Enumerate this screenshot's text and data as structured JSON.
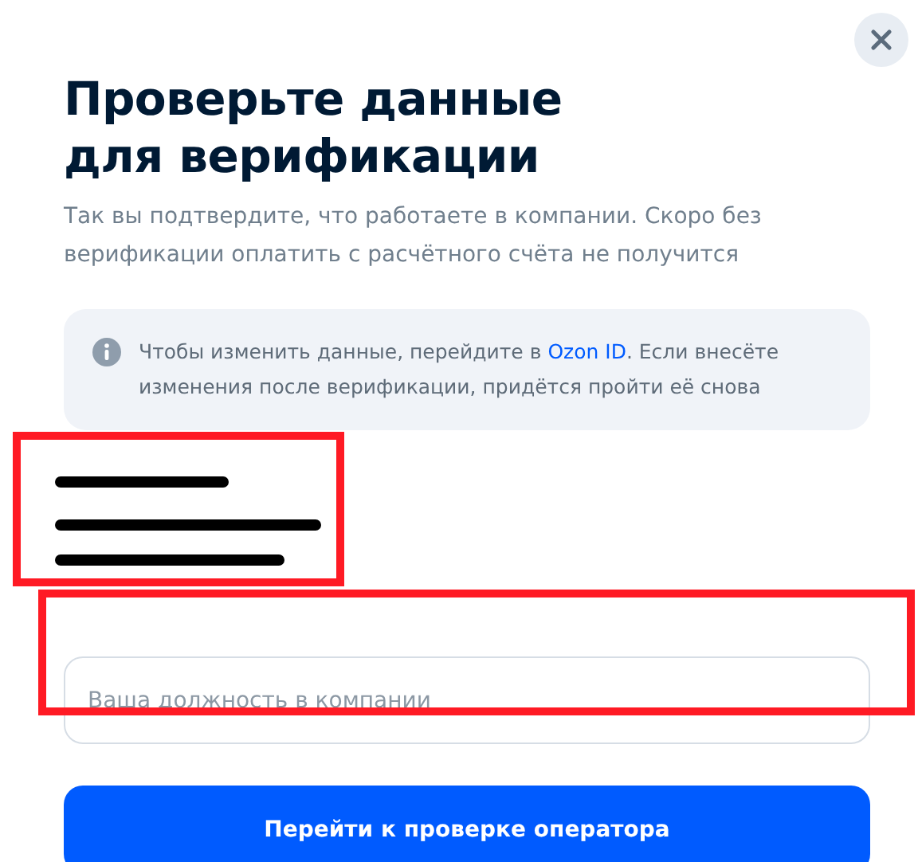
{
  "dialog": {
    "title": "Проверьте данные для верификации",
    "subtitle": "Так вы подтвердите, что работаете в компании. Скоро без верификации оплатить с расчётного счёта не получится",
    "notice": {
      "before": "Чтобы изменить данные, перейдите в ",
      "link": "Ozon ID",
      "after": ". Если внесёте изменения после верификации, придётся пройти её снова"
    },
    "position_field": {
      "placeholder": "Ваша должность в компании"
    },
    "submit_button": "Перейти к проверке оператора"
  }
}
